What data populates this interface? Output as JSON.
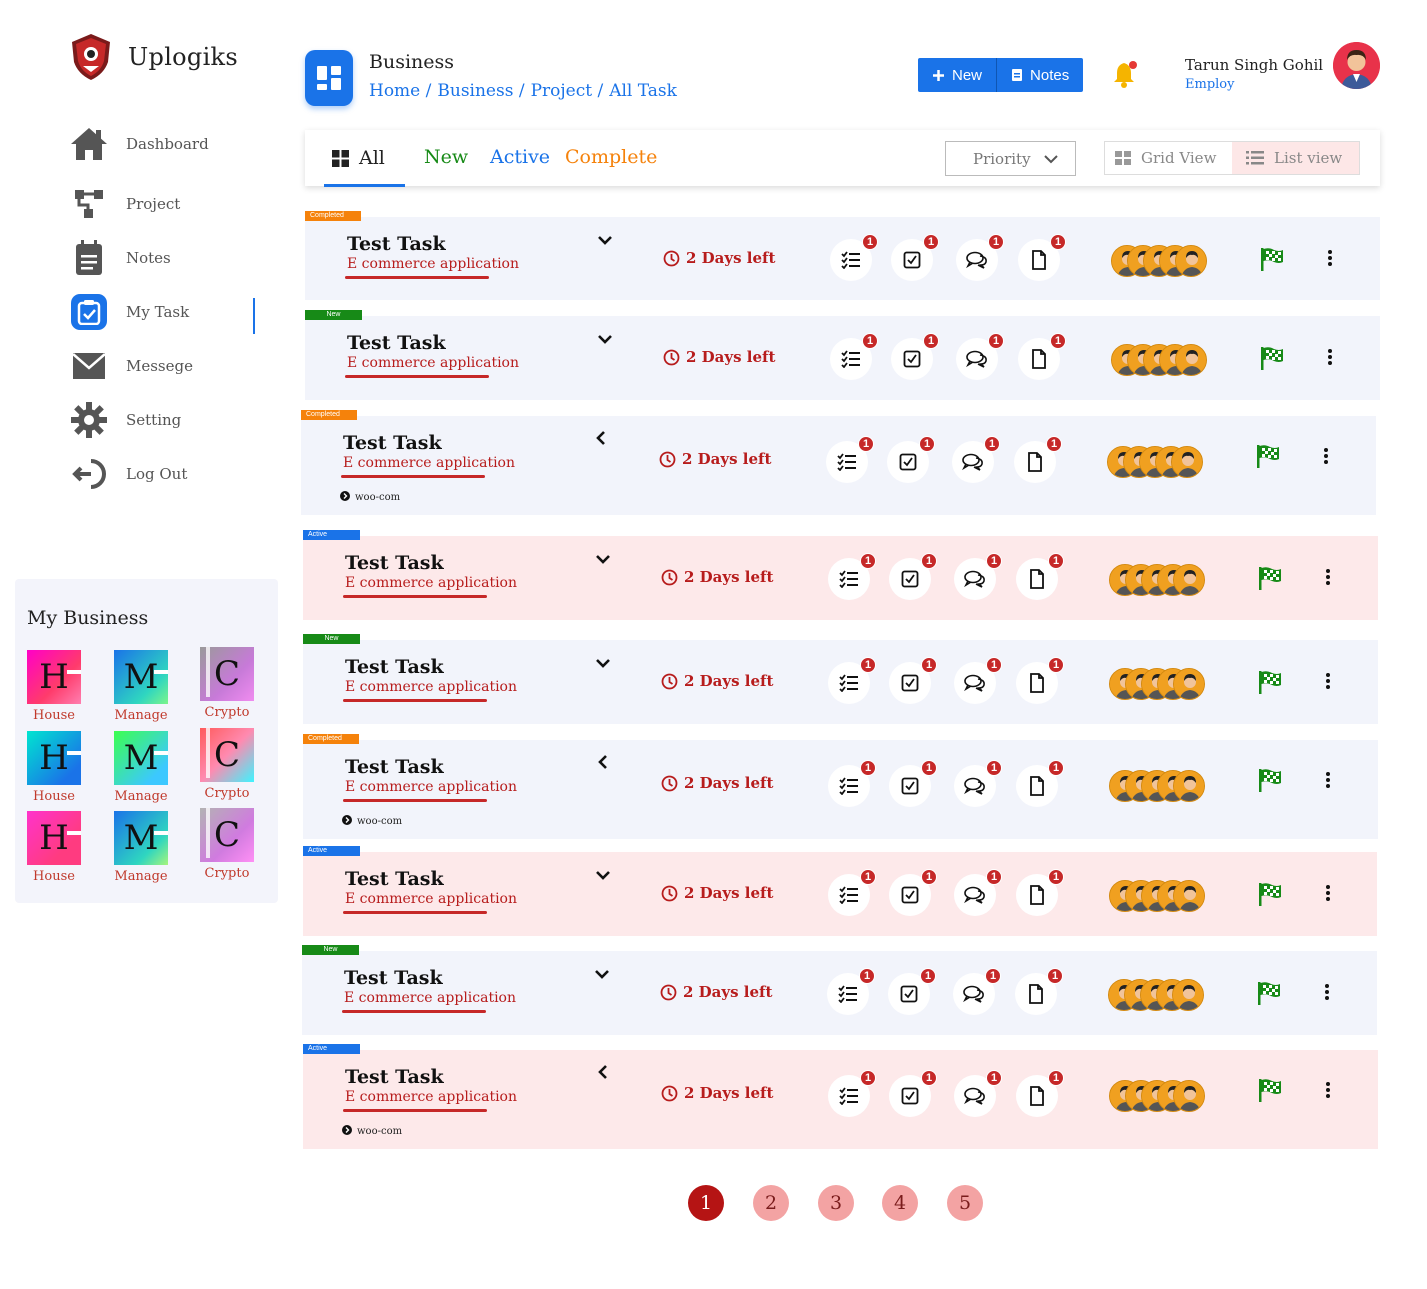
{
  "app": {
    "name": "Uplogiks"
  },
  "sidebar": {
    "items": [
      {
        "label": "Dashboard",
        "icon": "home-icon"
      },
      {
        "label": "Project",
        "icon": "project-icon"
      },
      {
        "label": "Notes",
        "icon": "notes-icon"
      },
      {
        "label": "My Task",
        "icon": "task-icon",
        "active": true
      },
      {
        "label": "Messege",
        "icon": "mail-icon"
      },
      {
        "label": "Setting",
        "icon": "gear-icon"
      },
      {
        "label": "Log Out",
        "icon": "logout-icon"
      }
    ]
  },
  "business": {
    "title": "My Business",
    "tiles": [
      {
        "letter": "H",
        "label": "House"
      },
      {
        "letter": "M",
        "label": "Manage"
      },
      {
        "letter": "C",
        "label": "Crypto"
      },
      {
        "letter": "H",
        "label": "House"
      },
      {
        "letter": "M",
        "label": "Manage"
      },
      {
        "letter": "C",
        "label": "Crypto"
      },
      {
        "letter": "H",
        "label": "House"
      },
      {
        "letter": "M",
        "label": "Manage"
      },
      {
        "letter": "C",
        "label": "Crypto"
      }
    ]
  },
  "header": {
    "title": "Business",
    "breadcrumb": [
      "Home /",
      "Business /",
      "Project /",
      "All Task"
    ],
    "new_label": "New",
    "notes_label": "Notes",
    "user_name": "Tarun Singh Gohil",
    "user_role": "Employ"
  },
  "filters": {
    "tabs": [
      {
        "label": "All",
        "color": "#222222"
      },
      {
        "label": "New",
        "color": "#178a17"
      },
      {
        "label": "Active",
        "color": "#1a73e8"
      },
      {
        "label": "Complete",
        "color": "#f5820b"
      }
    ],
    "priority_label": "Priority",
    "grid_view_label": "Grid View",
    "list_view_label": "List view"
  },
  "tasks": [
    {
      "status": "Completed",
      "title": "Test Task",
      "subtitle": "E commerce application",
      "due": "2 Days left",
      "counts": [
        "1",
        "1",
        "1",
        "1"
      ],
      "tag": ""
    },
    {
      "status": "New",
      "title": "Test Task",
      "subtitle": "E commerce application",
      "due": "2 Days left",
      "counts": [
        "1",
        "1",
        "1",
        "1"
      ],
      "tag": ""
    },
    {
      "status": "Completed",
      "title": "Test Task",
      "subtitle": "E commerce application",
      "due": "2 Days left",
      "counts": [
        "1",
        "1",
        "1",
        "1"
      ],
      "tag": "woo-com"
    },
    {
      "status": "Active",
      "title": "Test Task",
      "subtitle": "E commerce application",
      "due": "2 Days left",
      "counts": [
        "1",
        "1",
        "1",
        "1"
      ],
      "tag": ""
    },
    {
      "status": "New",
      "title": "Test Task",
      "subtitle": "E commerce application",
      "due": "2 Days left",
      "counts": [
        "1",
        "1",
        "1",
        "1"
      ],
      "tag": ""
    },
    {
      "status": "Completed",
      "title": "Test Task",
      "subtitle": "E commerce application",
      "due": "2 Days left",
      "counts": [
        "1",
        "1",
        "1",
        "1"
      ],
      "tag": "woo-com"
    },
    {
      "status": "Active",
      "title": "Test Task",
      "subtitle": "E commerce application",
      "due": "2 Days left",
      "counts": [
        "1",
        "1",
        "1",
        "1"
      ],
      "tag": ""
    },
    {
      "status": "New",
      "title": "Test Task",
      "subtitle": "E commerce application",
      "due": "2 Days left",
      "counts": [
        "1",
        "1",
        "1",
        "1"
      ],
      "tag": ""
    },
    {
      "status": "Active",
      "title": "Test Task",
      "subtitle": "E commerce application",
      "due": "2 Days left",
      "counts": [
        "1",
        "1",
        "1",
        "1"
      ],
      "tag": "woo-com"
    }
  ],
  "pagination": {
    "pages": [
      "1",
      "2",
      "3",
      "4",
      "5"
    ],
    "current": "1"
  },
  "colors": {
    "accent": "#1a73e8",
    "danger": "#c62828",
    "completed": "#f5820b",
    "new": "#178a17",
    "flag": "#178a17"
  }
}
